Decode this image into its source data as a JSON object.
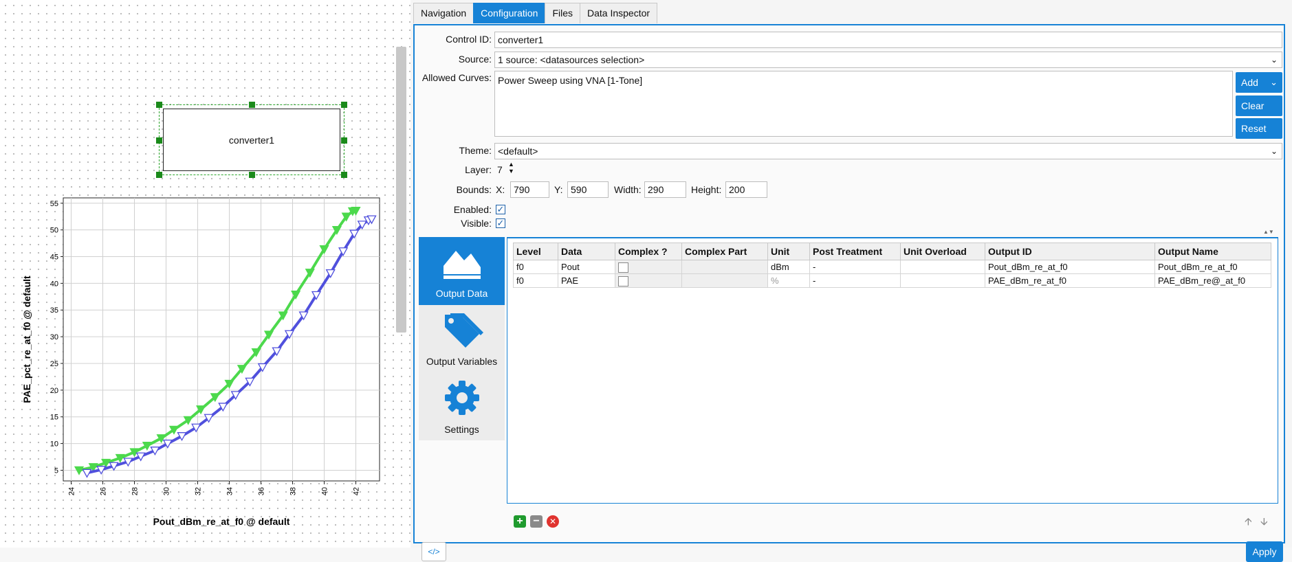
{
  "canvas": {
    "component_label": "converter1"
  },
  "chart_data": {
    "type": "line",
    "title": "",
    "xlabel": "Pout_dBm_re_at_f0 @ default",
    "ylabel": "PAE_pct_re_at_f0 @ default",
    "xlim": [
      23.5,
      43.5
    ],
    "ylim": [
      3,
      56
    ],
    "xticks": [
      24,
      26,
      28,
      30,
      32,
      34,
      36,
      38,
      40,
      42
    ],
    "yticks": [
      5,
      10,
      15,
      20,
      25,
      30,
      35,
      40,
      45,
      50,
      55
    ],
    "grid": true,
    "series": [
      {
        "color": "#4cd94c",
        "marker": "filled-triangle-down",
        "x": [
          24.5,
          25.4,
          26.2,
          27.1,
          28.0,
          28.8,
          29.7,
          30.5,
          31.4,
          32.2,
          33.1,
          34.0,
          34.8,
          35.7,
          36.5,
          37.4,
          38.2,
          39.1,
          40.0,
          40.8,
          41.4,
          41.8,
          42.0
        ],
        "y": [
          5.0,
          5.6,
          6.4,
          7.3,
          8.4,
          9.6,
          11.0,
          12.6,
          14.4,
          16.4,
          18.7,
          21.2,
          24.0,
          27.1,
          30.4,
          34.0,
          37.9,
          42.0,
          46.4,
          50.0,
          52.5,
          53.5,
          53.6
        ]
      },
      {
        "color": "#5050dd",
        "marker": "open-triangle-down",
        "x": [
          25.0,
          25.9,
          26.7,
          27.6,
          28.4,
          29.3,
          30.1,
          31.0,
          31.9,
          32.7,
          33.6,
          34.4,
          35.3,
          36.1,
          37.0,
          37.8,
          38.7,
          39.5,
          40.4,
          41.2,
          41.9,
          42.4,
          42.8,
          43.0
        ],
        "y": [
          4.5,
          5.1,
          5.8,
          6.6,
          7.6,
          8.7,
          10.0,
          11.4,
          13.0,
          14.8,
          16.9,
          19.1,
          21.6,
          24.3,
          27.3,
          30.5,
          34.0,
          37.8,
          41.9,
          46.0,
          49.3,
          51.0,
          51.8,
          52.0
        ]
      }
    ]
  },
  "tabs": [
    "Navigation",
    "Configuration",
    "Files",
    "Data Inspector"
  ],
  "active_tab": "Configuration",
  "form": {
    "control_id_label": "Control ID:",
    "control_id_value": "converter1",
    "source_label": "Source:",
    "source_value": "1 source: <datasources selection>",
    "allowed_curves_label": "Allowed Curves:",
    "allowed_curves_value": "Power Sweep using VNA [1-Tone]",
    "add_label": "Add",
    "clear_label": "Clear",
    "reset_label": "Reset",
    "theme_label": "Theme:",
    "theme_value": "<default>",
    "layer_label": "Layer:",
    "layer_value": "7",
    "bounds_label": "Bounds:",
    "x_label": "X:",
    "x_value": "790",
    "y_label": "Y:",
    "y_value": "590",
    "width_label": "Width:",
    "width_value": "290",
    "height_label": "Height:",
    "height_value": "200",
    "enabled_label": "Enabled:",
    "visible_label": "Visible:",
    "enabled": true,
    "visible": true
  },
  "sidebar": {
    "items": [
      {
        "label": "Output Data",
        "icon": "mountain-icon",
        "active": true
      },
      {
        "label": "Output Variables",
        "icon": "tags-icon",
        "active": false
      },
      {
        "label": "Settings",
        "icon": "gear-icon",
        "active": false
      }
    ]
  },
  "table": {
    "headers": [
      "Level",
      "Data",
      "Complex ?",
      "Complex Part",
      "Unit",
      "Post Treatment",
      "Unit Overload",
      "Output ID",
      "Output Name"
    ],
    "rows": [
      {
        "level": "f0",
        "data": "Pout",
        "complex": false,
        "complex_part": "",
        "unit": "dBm",
        "post_treatment": "-",
        "unit_overload": "",
        "output_id": "Pout_dBm_re_at_f0",
        "output_name": "Pout_dBm_re_at_f0"
      },
      {
        "level": "f0",
        "data": "PAE",
        "complex": false,
        "complex_part": "",
        "unit": "%",
        "post_treatment": "-",
        "unit_overload": "",
        "output_id": "PAE_dBm_re_at_f0",
        "output_name": "PAE_dBm_re@_at_f0"
      }
    ]
  },
  "footer": {
    "apply_label": "Apply",
    "code_label": "</>"
  }
}
